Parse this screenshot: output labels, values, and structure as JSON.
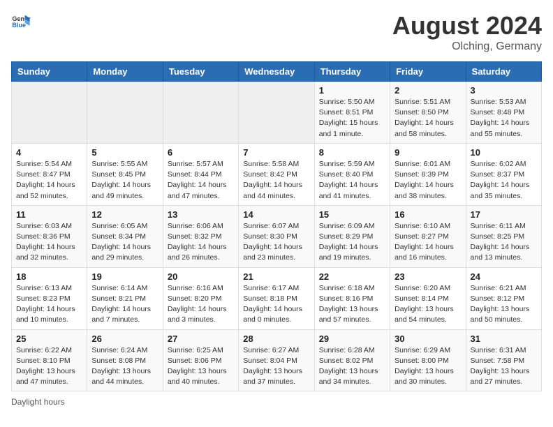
{
  "header": {
    "logo_general": "General",
    "logo_blue": "Blue",
    "month_year": "August 2024",
    "location": "Olching, Germany"
  },
  "calendar": {
    "days_of_week": [
      "Sunday",
      "Monday",
      "Tuesday",
      "Wednesday",
      "Thursday",
      "Friday",
      "Saturday"
    ],
    "weeks": [
      [
        {
          "day": "",
          "info": ""
        },
        {
          "day": "",
          "info": ""
        },
        {
          "day": "",
          "info": ""
        },
        {
          "day": "",
          "info": ""
        },
        {
          "day": "1",
          "info": "Sunrise: 5:50 AM\nSunset: 8:51 PM\nDaylight: 15 hours and 1 minute."
        },
        {
          "day": "2",
          "info": "Sunrise: 5:51 AM\nSunset: 8:50 PM\nDaylight: 14 hours and 58 minutes."
        },
        {
          "day": "3",
          "info": "Sunrise: 5:53 AM\nSunset: 8:48 PM\nDaylight: 14 hours and 55 minutes."
        }
      ],
      [
        {
          "day": "4",
          "info": "Sunrise: 5:54 AM\nSunset: 8:47 PM\nDaylight: 14 hours and 52 minutes."
        },
        {
          "day": "5",
          "info": "Sunrise: 5:55 AM\nSunset: 8:45 PM\nDaylight: 14 hours and 49 minutes."
        },
        {
          "day": "6",
          "info": "Sunrise: 5:57 AM\nSunset: 8:44 PM\nDaylight: 14 hours and 47 minutes."
        },
        {
          "day": "7",
          "info": "Sunrise: 5:58 AM\nSunset: 8:42 PM\nDaylight: 14 hours and 44 minutes."
        },
        {
          "day": "8",
          "info": "Sunrise: 5:59 AM\nSunset: 8:40 PM\nDaylight: 14 hours and 41 minutes."
        },
        {
          "day": "9",
          "info": "Sunrise: 6:01 AM\nSunset: 8:39 PM\nDaylight: 14 hours and 38 minutes."
        },
        {
          "day": "10",
          "info": "Sunrise: 6:02 AM\nSunset: 8:37 PM\nDaylight: 14 hours and 35 minutes."
        }
      ],
      [
        {
          "day": "11",
          "info": "Sunrise: 6:03 AM\nSunset: 8:36 PM\nDaylight: 14 hours and 32 minutes."
        },
        {
          "day": "12",
          "info": "Sunrise: 6:05 AM\nSunset: 8:34 PM\nDaylight: 14 hours and 29 minutes."
        },
        {
          "day": "13",
          "info": "Sunrise: 6:06 AM\nSunset: 8:32 PM\nDaylight: 14 hours and 26 minutes."
        },
        {
          "day": "14",
          "info": "Sunrise: 6:07 AM\nSunset: 8:30 PM\nDaylight: 14 hours and 23 minutes."
        },
        {
          "day": "15",
          "info": "Sunrise: 6:09 AM\nSunset: 8:29 PM\nDaylight: 14 hours and 19 minutes."
        },
        {
          "day": "16",
          "info": "Sunrise: 6:10 AM\nSunset: 8:27 PM\nDaylight: 14 hours and 16 minutes."
        },
        {
          "day": "17",
          "info": "Sunrise: 6:11 AM\nSunset: 8:25 PM\nDaylight: 14 hours and 13 minutes."
        }
      ],
      [
        {
          "day": "18",
          "info": "Sunrise: 6:13 AM\nSunset: 8:23 PM\nDaylight: 14 hours and 10 minutes."
        },
        {
          "day": "19",
          "info": "Sunrise: 6:14 AM\nSunset: 8:21 PM\nDaylight: 14 hours and 7 minutes."
        },
        {
          "day": "20",
          "info": "Sunrise: 6:16 AM\nSunset: 8:20 PM\nDaylight: 14 hours and 3 minutes."
        },
        {
          "day": "21",
          "info": "Sunrise: 6:17 AM\nSunset: 8:18 PM\nDaylight: 14 hours and 0 minutes."
        },
        {
          "day": "22",
          "info": "Sunrise: 6:18 AM\nSunset: 8:16 PM\nDaylight: 13 hours and 57 minutes."
        },
        {
          "day": "23",
          "info": "Sunrise: 6:20 AM\nSunset: 8:14 PM\nDaylight: 13 hours and 54 minutes."
        },
        {
          "day": "24",
          "info": "Sunrise: 6:21 AM\nSunset: 8:12 PM\nDaylight: 13 hours and 50 minutes."
        }
      ],
      [
        {
          "day": "25",
          "info": "Sunrise: 6:22 AM\nSunset: 8:10 PM\nDaylight: 13 hours and 47 minutes."
        },
        {
          "day": "26",
          "info": "Sunrise: 6:24 AM\nSunset: 8:08 PM\nDaylight: 13 hours and 44 minutes."
        },
        {
          "day": "27",
          "info": "Sunrise: 6:25 AM\nSunset: 8:06 PM\nDaylight: 13 hours and 40 minutes."
        },
        {
          "day": "28",
          "info": "Sunrise: 6:27 AM\nSunset: 8:04 PM\nDaylight: 13 hours and 37 minutes."
        },
        {
          "day": "29",
          "info": "Sunrise: 6:28 AM\nSunset: 8:02 PM\nDaylight: 13 hours and 34 minutes."
        },
        {
          "day": "30",
          "info": "Sunrise: 6:29 AM\nSunset: 8:00 PM\nDaylight: 13 hours and 30 minutes."
        },
        {
          "day": "31",
          "info": "Sunrise: 6:31 AM\nSunset: 7:58 PM\nDaylight: 13 hours and 27 minutes."
        }
      ]
    ]
  },
  "footer": {
    "note": "Daylight hours"
  }
}
